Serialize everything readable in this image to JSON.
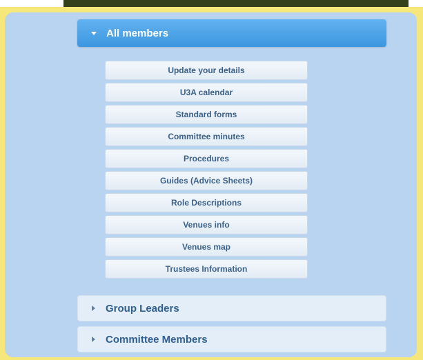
{
  "accordion": {
    "open_section": {
      "label": "All members",
      "icon": "caret-down-icon"
    },
    "items": [
      {
        "label": "Update your details"
      },
      {
        "label": "U3A calendar"
      },
      {
        "label": "Standard forms"
      },
      {
        "label": "Committee minutes"
      },
      {
        "label": "Procedures"
      },
      {
        "label": "Guides (Advice Sheets)"
      },
      {
        "label": "Role Descriptions"
      },
      {
        "label": "Venues info"
      },
      {
        "label": "Venues map"
      },
      {
        "label": "Trustees Information"
      }
    ],
    "closed_sections": [
      {
        "label": "Group Leaders",
        "icon": "caret-right-icon"
      },
      {
        "label": "Committee Members",
        "icon": "caret-right-icon"
      }
    ]
  },
  "colors": {
    "frame": "#f6e77a",
    "panel": "#b9d4f1",
    "header_active": "#3c97df",
    "item_text": "#3c6188",
    "closed_header_bg": "#e4eef8"
  }
}
